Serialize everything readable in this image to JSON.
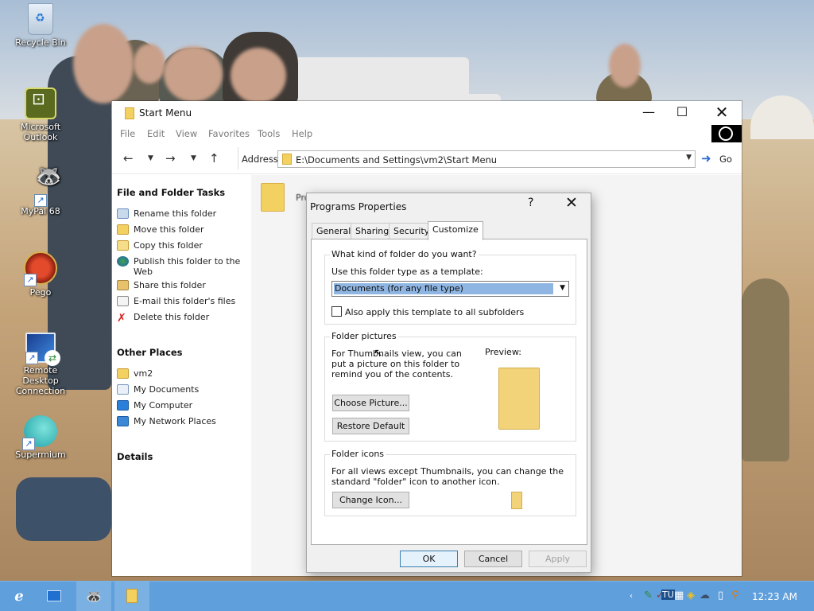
{
  "desktop": {
    "icons": [
      {
        "label": "Recycle Bin"
      },
      {
        "label": "Microsoft Outlook"
      },
      {
        "label": "MyPal 68"
      },
      {
        "label": "Pego"
      },
      {
        "label": "Remote Desktop Connection"
      },
      {
        "label": "Supermium"
      }
    ]
  },
  "explorer": {
    "title": "Start Menu",
    "menu": [
      "File",
      "Edit",
      "View",
      "Favorites",
      "Tools",
      "Help"
    ],
    "address_label": "Address",
    "address_value": "E:\\Documents and Settings\\vm2\\Start Menu",
    "go_label": "Go",
    "task_panel": {
      "file_tasks_header": "File and Folder Tasks",
      "file_tasks": [
        {
          "label": "Rename this folder",
          "icon": "rename-icon"
        },
        {
          "label": "Move this folder",
          "icon": "move-icon"
        },
        {
          "label": "Copy this folder",
          "icon": "copy-icon"
        },
        {
          "label": "Publish this folder to the Web",
          "icon": "globe-icon"
        },
        {
          "label": "Share this folder",
          "icon": "share-icon"
        },
        {
          "label": "E-mail this folder's files",
          "icon": "email-icon"
        },
        {
          "label": "Delete this folder",
          "icon": "delete-icon"
        }
      ],
      "other_places_header": "Other Places",
      "other_places": [
        {
          "label": "vm2",
          "icon": "folder-icon"
        },
        {
          "label": "My Documents",
          "icon": "documents-icon"
        },
        {
          "label": "My Computer",
          "icon": "computer-icon"
        },
        {
          "label": "My Network Places",
          "icon": "network-icon"
        }
      ],
      "details_header": "Details"
    },
    "content_items": [
      {
        "label": "Programs"
      }
    ]
  },
  "dialog": {
    "title": "Programs Properties",
    "help": "?",
    "tabs": [
      "General",
      "Sharing",
      "Security",
      "Customize"
    ],
    "active_tab": "Customize",
    "folder_kind": {
      "legend": "What kind of folder do you want?",
      "template_label": "Use this folder type as a template:",
      "template_value": "Documents (for any file type)",
      "apply_subfolders": "Also apply this template to all subfolders",
      "apply_subfolders_checked": false
    },
    "folder_pictures": {
      "legend": "Folder pictures",
      "description": "For Thumbnails view, you can put a picture on this folder to remind you of the contents.",
      "preview_label": "Preview:",
      "choose_button": "Choose Picture...",
      "restore_button": "Restore Default"
    },
    "folder_icons": {
      "legend": "Folder icons",
      "description": "For all views except Thumbnails, you can change the standard \"folder\" icon to another icon.",
      "change_button": "Change Icon..."
    },
    "buttons": {
      "ok": "OK",
      "cancel": "Cancel",
      "apply": "Apply"
    }
  },
  "taskbar": {
    "clock": "12:23 AM",
    "accent": "#5f9fdc"
  }
}
